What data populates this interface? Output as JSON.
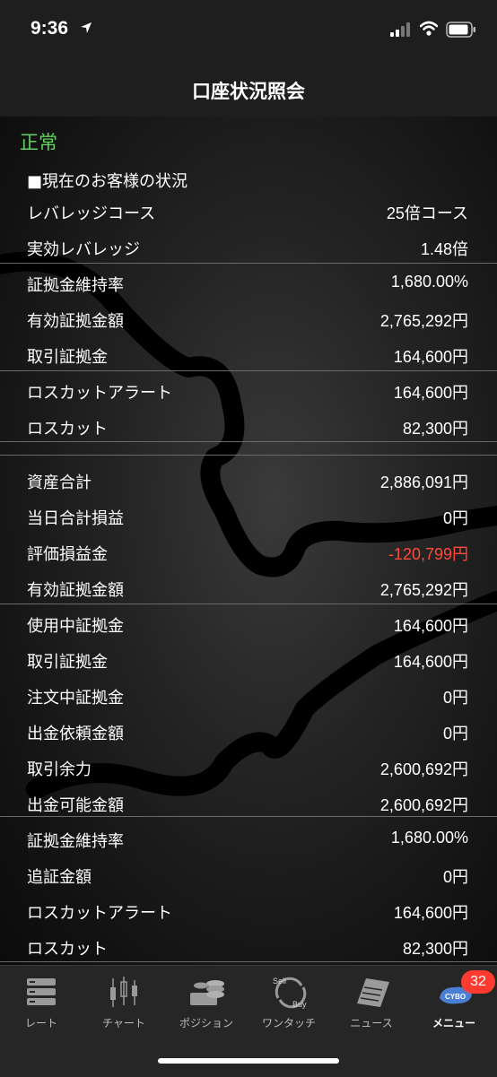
{
  "status_bar": {
    "time": "9:36"
  },
  "header": {
    "title": "口座状況照会"
  },
  "account": {
    "status": "正常",
    "section_title": "■現在のお客様の状況",
    "rows": [
      {
        "label": "レバレッジコース",
        "value": "25倍コース"
      },
      {
        "label": "実効レバレッジ",
        "value": "1.48倍"
      },
      {
        "label": "証拠金維持率",
        "value": "1,680.00%"
      },
      {
        "label": "有効証拠金額",
        "value": "2,765,292円"
      },
      {
        "label": "取引証拠金",
        "value": "164,600円"
      },
      {
        "label": "ロスカットアラート",
        "value": "164,600円"
      },
      {
        "label": "ロスカット",
        "value": "82,300円"
      },
      {
        "label": "資産合計",
        "value": "2,886,091円"
      },
      {
        "label": "当日合計損益",
        "value": "0円"
      },
      {
        "label": "評価損益金",
        "value": "-120,799円",
        "color": "#ff4a3a"
      },
      {
        "label": "有効証拠金額",
        "value": "2,765,292円"
      },
      {
        "label": "使用中証拠金",
        "value": "164,600円"
      },
      {
        "label": "取引証拠金",
        "value": "164,600円"
      },
      {
        "label": "注文中証拠金",
        "value": "0円"
      },
      {
        "label": "出金依頼金額",
        "value": "0円"
      },
      {
        "label": "取引余力",
        "value": "2,600,692円"
      },
      {
        "label": "出金可能金額",
        "value": "2,600,692円"
      },
      {
        "label": "証拠金維持率",
        "value": "1,680.00%"
      },
      {
        "label": "追証金額",
        "value": "0円"
      },
      {
        "label": "ロスカットアラート",
        "value": "164,600円"
      },
      {
        "label": "ロスカット",
        "value": "82,300円"
      }
    ]
  },
  "tab_bar": {
    "tabs": [
      {
        "label": "レート",
        "icon": "server-stack-icon"
      },
      {
        "label": "チャート",
        "icon": "candlestick-icon"
      },
      {
        "label": "ポジション",
        "icon": "coins-icon"
      },
      {
        "label": "ワンタッチ",
        "icon": "sell-buy-icon"
      },
      {
        "label": "ニュース",
        "icon": "newspaper-icon"
      },
      {
        "label": "メニュー",
        "icon": "cyber-menu-icon"
      }
    ],
    "active_tab": "メニュー",
    "badge_count": "32"
  },
  "colors": {
    "status_normal": "#5fd35f",
    "negative": "#ff4a3a",
    "badge": "#ff3b30"
  }
}
